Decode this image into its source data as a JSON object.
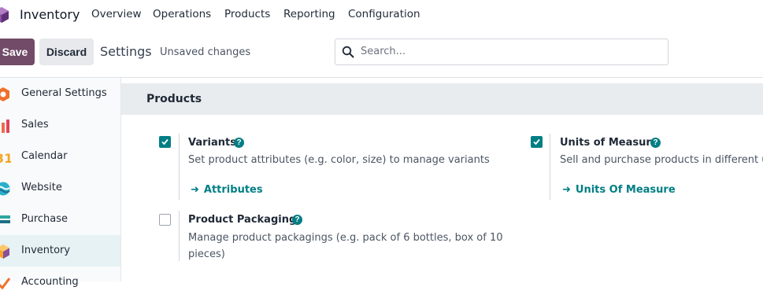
{
  "topnav": {
    "app_name": "Inventory",
    "menu": [
      "Overview",
      "Operations",
      "Products",
      "Reporting",
      "Configuration"
    ]
  },
  "control": {
    "save_label": "Save",
    "discard_label": "Discard",
    "title": "Settings",
    "status": "Unsaved changes",
    "search_placeholder": "Search..."
  },
  "sidebar": {
    "items": [
      {
        "label": "General Settings",
        "icon": "general-settings-icon"
      },
      {
        "label": "Sales",
        "icon": "sales-icon"
      },
      {
        "label": "Calendar",
        "icon": "calendar-icon"
      },
      {
        "label": "Website",
        "icon": "website-icon"
      },
      {
        "label": "Purchase",
        "icon": "purchase-icon"
      },
      {
        "label": "Inventory",
        "icon": "inventory-icon",
        "active": true
      },
      {
        "label": "Accounting",
        "icon": "accounting-icon"
      }
    ]
  },
  "section": {
    "title": "Products",
    "settings": [
      {
        "title": "Variants",
        "checked": true,
        "description": "Set product attributes (e.g. color, size) to manage variants",
        "link": "Attributes"
      },
      {
        "title": "Units of Measure",
        "checked": true,
        "description": "Sell and purchase products in different un",
        "link": "Units Of Measure"
      },
      {
        "title": "Product Packagings",
        "checked": false,
        "description_lines": [
          "Manage product packagings (e.g. pack of 6 bottles, box of 10",
          "pieces)"
        ]
      }
    ]
  },
  "colors": {
    "brand": "#714b67",
    "accent": "#017e84"
  }
}
